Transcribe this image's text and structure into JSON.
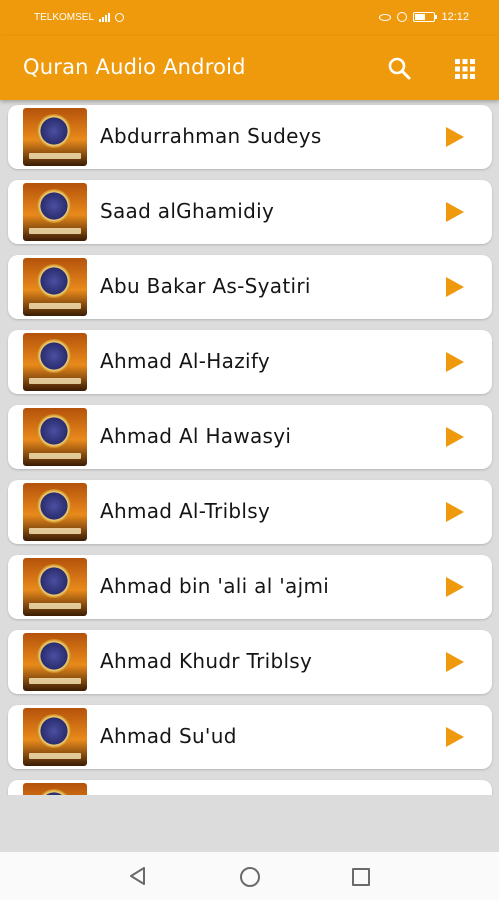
{
  "status_bar": {
    "carrier": "TELKOMSEL",
    "battery_level": "",
    "time": "12:12"
  },
  "app_bar": {
    "title": "Quran Audio Android",
    "search_icon": "search-icon",
    "menu_icon": "grid-icon"
  },
  "reciters": [
    {
      "name": "Abdurrahman Sudeys"
    },
    {
      "name": "Saad alGhamidiy"
    },
    {
      "name": "Abu Bakar As-Syatiri"
    },
    {
      "name": "Ahmad Al-Hazify"
    },
    {
      "name": "Ahmad Al Hawasyi"
    },
    {
      "name": "Ahmad Al-Triblsy"
    },
    {
      "name": "Ahmad bin 'ali al 'ajmi"
    },
    {
      "name": "Ahmad Khudr Triblsy"
    },
    {
      "name": "Ahmad Su'ud"
    },
    {
      "name": ""
    }
  ],
  "colors": {
    "accent": "#ef9a0d",
    "background": "#dcdcdc"
  },
  "nav_bar": {
    "back_icon": "back-triangle-icon",
    "home_icon": "home-circle-icon",
    "recents_icon": "recents-square-icon"
  }
}
